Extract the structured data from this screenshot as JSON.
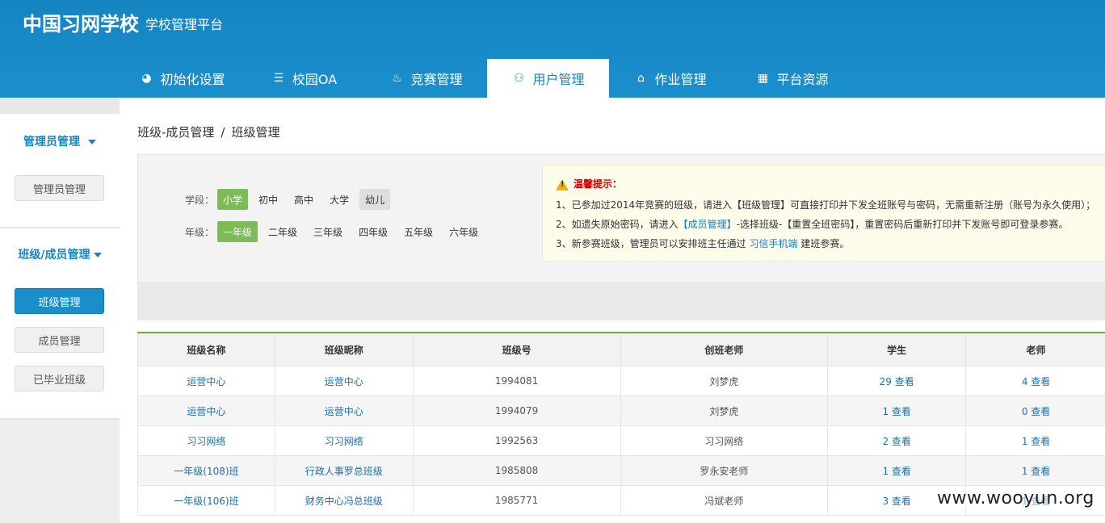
{
  "brand": {
    "title": "中国习网学校",
    "subtitle": "学校管理平台"
  },
  "nav": [
    {
      "label": "初始化设置",
      "icon": "pie-icon"
    },
    {
      "label": "校园OA",
      "icon": "list-icon"
    },
    {
      "label": "竞赛管理",
      "icon": "flame-icon"
    },
    {
      "label": "用户管理",
      "icon": "users-icon"
    },
    {
      "label": "作业管理",
      "icon": "inbox-icon"
    },
    {
      "label": "平台资源",
      "icon": "storefront-icon"
    }
  ],
  "sidebar": {
    "section1_title": "管理员管理",
    "section1_items": [
      "管理员管理"
    ],
    "section2_title": "班级/成员管理",
    "section2_items": [
      "班级管理",
      "成员管理",
      "已毕业班级"
    ]
  },
  "breadcrumb": {
    "parent": "班级-成员管理",
    "sep": "/",
    "current": "班级管理"
  },
  "filter": {
    "stage_label": "学段：",
    "stages": [
      "小学",
      "初中",
      "高中",
      "大学",
      "幼儿"
    ],
    "grade_label": "年级：",
    "grades": [
      "一年级",
      "二年级",
      "三年级",
      "四年级",
      "五年级",
      "六年级"
    ]
  },
  "notice": {
    "title": "温馨提示：",
    "line1": "1、已参加过2014年竞赛的班级，请进入【班级管理】可直接打印并下发全班账号与密码，无需重新注册（账号为永久使用）；",
    "line2_a": "2、如遗失原始密码，请进入",
    "line2_link": "【成员管理】",
    "line2_b": "-选择班级-【重置全班密码】，重置密码后重新打印并下发账号即可登录参赛。",
    "line3_a": "3、新参赛班级，管理员可以安排班主任通过",
    "line3_link": "习信手机端",
    "line3_b": "建班参赛。"
  },
  "table": {
    "headers": [
      "班级名称",
      "班级昵称",
      "班级号",
      "创班老师",
      "学生",
      "老师"
    ],
    "view_label": "查看",
    "rows": [
      {
        "name": "运营中心",
        "nick": "运营中心",
        "id": "1994081",
        "teacher": "刘梦虎",
        "students": "29",
        "teachers": "4"
      },
      {
        "name": "运营中心",
        "nick": "运营中心",
        "id": "1994079",
        "teacher": "刘梦虎",
        "students": "1",
        "teachers": "0"
      },
      {
        "name": "习习网络",
        "nick": "习习网络",
        "id": "1992563",
        "teacher": "习习网络",
        "students": "2",
        "teachers": "1"
      },
      {
        "name": "一年级(108)班",
        "nick": "行政人事罗总班级",
        "id": "1985808",
        "teacher": "罗永安老师",
        "students": "1",
        "teachers": "1"
      },
      {
        "name": "一年级(106)班",
        "nick": "财务中心冯总班级",
        "id": "1985771",
        "teacher": "冯斌老师",
        "students": "3",
        "teachers": "1"
      }
    ]
  },
  "watermark": "www.wooyun.org"
}
